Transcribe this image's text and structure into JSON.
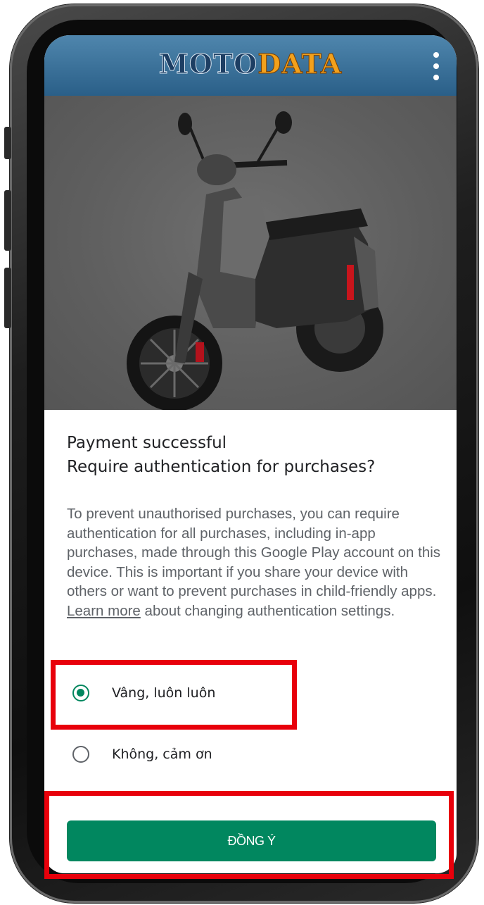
{
  "app": {
    "logo_part1": "MOTO",
    "logo_part2": "DATA",
    "menu_icon": "more-vert-icon"
  },
  "hero": {
    "image": "scooter-photo"
  },
  "dialog": {
    "title_line1": "Payment successful",
    "title_line2": "Require authentication for purchases?",
    "body_before_link": "To prevent unauthorised purchases, you can require authentication for all purchases, including in-app purchases, made through this Google Play account on this device. This is important if you share your device with others or want to prevent purchases in child-friendly apps. ",
    "link_text": "Learn more",
    "body_after_link": " about changing authentication settings.",
    "options": [
      {
        "label": "Vâng, luôn luôn",
        "selected": true
      },
      {
        "label": "Không, cảm ơn",
        "selected": false
      }
    ],
    "confirm_label": "ĐỒNG Ý"
  },
  "colors": {
    "accent": "#01875f",
    "highlight": "#e8000b",
    "header": "#2a5f88",
    "logo_data": "#f3a11c"
  }
}
